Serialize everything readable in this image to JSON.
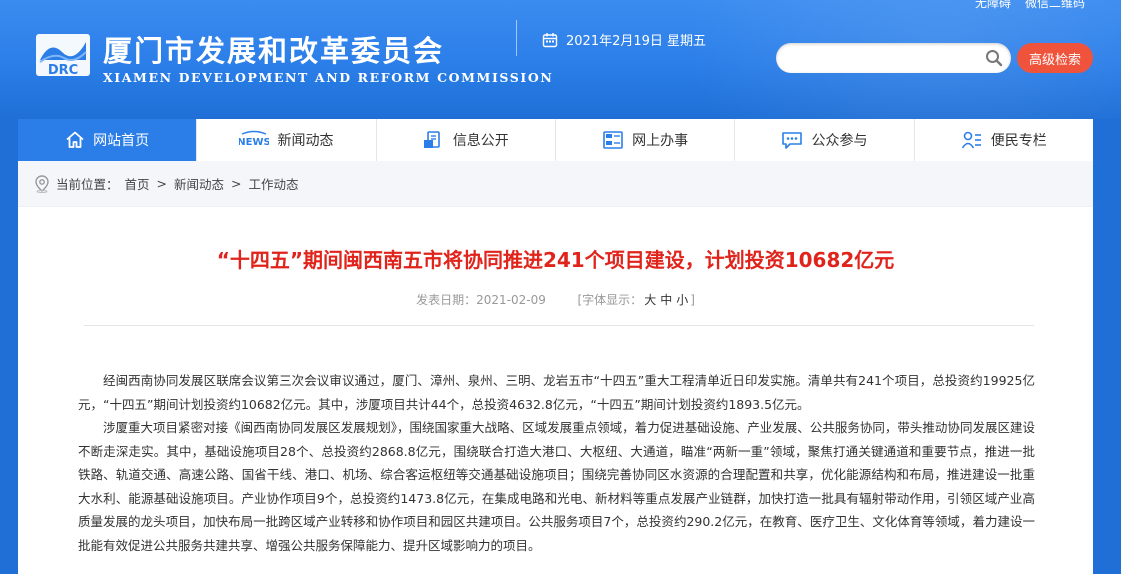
{
  "header": {
    "top_links": [
      "无障碍",
      "微信二维码"
    ],
    "logo_text": "DRC",
    "site_title": "厦门市发展和改革委员会",
    "site_subtitle": "XIAMEN DEVELOPMENT AND REFORM COMMISSION",
    "date": "2021年2月19日 星期五",
    "search_placeholder": "",
    "advanced_search_label": "高级检索"
  },
  "nav": {
    "items": [
      {
        "label": "网站首页",
        "icon": "home-icon"
      },
      {
        "label": "新闻动态",
        "icon": "news-icon"
      },
      {
        "label": "信息公开",
        "icon": "document-icon"
      },
      {
        "label": "网上办事",
        "icon": "online-service-icon"
      },
      {
        "label": "公众参与",
        "icon": "chat-icon"
      },
      {
        "label": "便民专栏",
        "icon": "user-list-icon"
      }
    ],
    "news_icon_text": "NEWS"
  },
  "breadcrumb": {
    "prefix": "当前位置：",
    "items": [
      "首页",
      "新闻动态",
      "工作动态"
    ],
    "separator": ">"
  },
  "article": {
    "title": "“十四五”期间闽西南五市将协同推进241个项目建设，计划投资10682亿元",
    "date_label": "发表日期：",
    "date": "2021-02-09",
    "font_size_prefix": "[字体显示：",
    "font_sizes": [
      "大",
      "中",
      "小"
    ],
    "font_size_suffix": "]",
    "paragraphs": [
      "经闽西南协同发展区联席会议第三次会议审议通过，厦门、漳州、泉州、三明、龙岩五市“十四五”重大工程清单近日印发实施。清单共有241个项目，总投资约19925亿元，“十四五”期间计划投资约10682亿元。其中，涉厦项目共计44个，总投资4632.8亿元，“十四五”期间计划投资约1893.5亿元。",
      "涉厦重大项目紧密对接《闽西南协同发展区发展规划》，围绕国家重大战略、区域发展重点领域，着力促进基础设施、产业发展、公共服务协同，带头推动协同发展区建设不断走深走实。其中，基础设施项目28个、总投资约2868.8亿元，围绕联合打造大港口、大枢纽、大通道，瞄准“两新一重”领域，聚焦打通关键通道和重要节点，推进一批铁路、轨道交通、高速公路、国省干线、港口、机场、综合客运枢纽等交通基础设施项目；围绕完善协同区水资源的合理配置和共享，优化能源结构和布局，推进建设一批重大水利、能源基础设施项目。产业协作项目9个，总投资约1473.8亿元，在集成电路和光电、新材料等重点发展产业链群，加快打造一批具有辐射带动作用，引领区域产业高质量发展的龙头项目，加快布局一批跨区域产业转移和协作项目和园区共建项目。公共服务项目7个，总投资约290.2亿元，在教育、医疗卫生、文化体育等领域，着力建设一批能有效促进公共服务共建共享、增强公共服务保障能力、提升区域影响力的项目。"
    ]
  },
  "colors": {
    "header_blue": "#2b7ee8",
    "nav_active": "#2b7ee8",
    "title_red": "#e0231b",
    "adv_button": "#f0533c"
  }
}
